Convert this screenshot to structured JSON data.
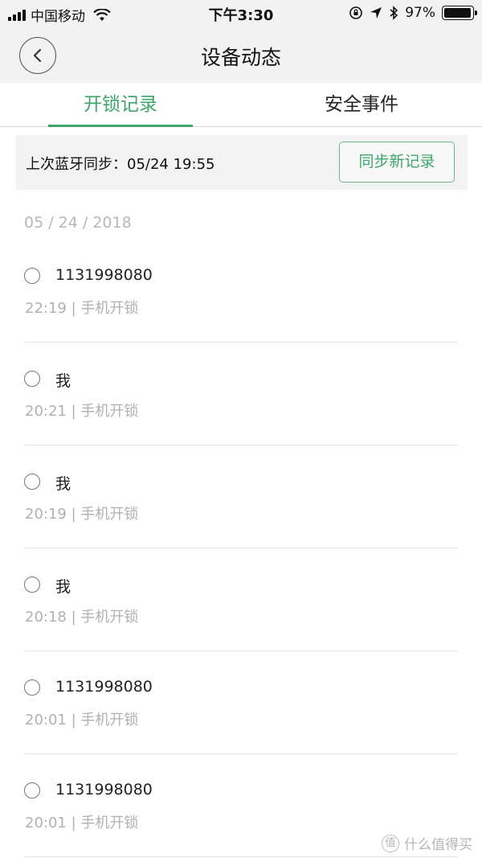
{
  "status_bar": {
    "carrier": "中国移动",
    "time": "下午3:30",
    "battery_percent": "97%",
    "battery_level": 0.97,
    "icons": [
      "signal-icon",
      "wifi-icon",
      "rotation-lock-icon",
      "location-icon",
      "bluetooth-icon",
      "battery-icon"
    ]
  },
  "nav": {
    "title": "设备动态",
    "back_icon": "chevron-left-icon"
  },
  "tabs": [
    {
      "label": "开锁记录",
      "active": true
    },
    {
      "label": "安全事件",
      "active": false
    }
  ],
  "sync": {
    "text": "上次蓝牙同步：05/24 19:55",
    "button_label": "同步新记录"
  },
  "date_header": "05 / 24 / 2018",
  "records": [
    {
      "name": "1131998080",
      "meta": "22:19 | 手机开锁"
    },
    {
      "name": "我",
      "meta": "20:21 | 手机开锁"
    },
    {
      "name": "我",
      "meta": "20:19 | 手机开锁"
    },
    {
      "name": "我",
      "meta": "20:18 | 手机开锁"
    },
    {
      "name": "1131998080",
      "meta": "20:01 | 手机开锁"
    },
    {
      "name": "1131998080",
      "meta": "20:01 | 手机开锁"
    }
  ],
  "watermark": {
    "logo_char": "值",
    "text": "什么值得买"
  },
  "colors": {
    "accent": "#3fa56b",
    "header_bg": "#f2f2f2",
    "muted_text": "#b0b0b0"
  }
}
